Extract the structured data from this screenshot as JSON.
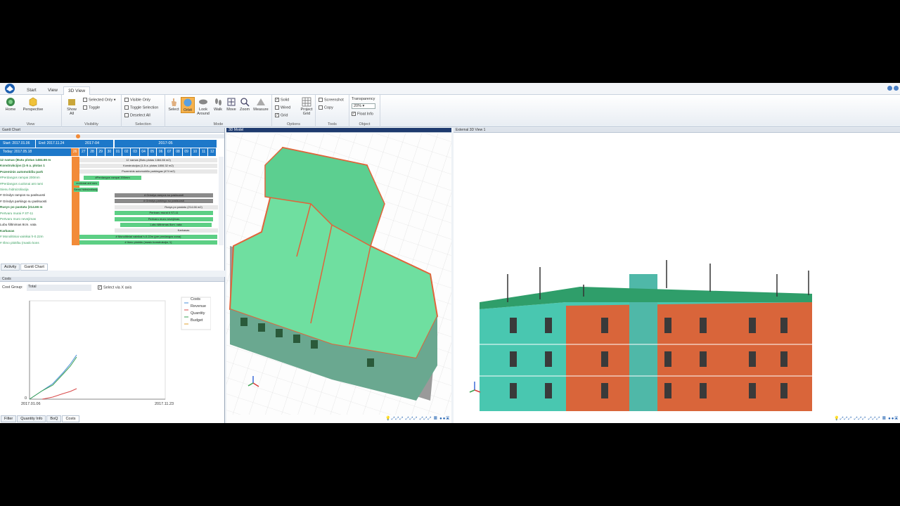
{
  "ribbon": {
    "tabs": [
      "Start",
      "View",
      "3D View"
    ],
    "active_tab": "3D View",
    "groups": {
      "view": {
        "label": "View",
        "home": "Home",
        "perspective": "Perspective"
      },
      "visibility": {
        "label": "Visibility",
        "show_all": "Show All",
        "selected_only": "Selected Only",
        "toggle": "Toggle"
      },
      "selection": {
        "label": "Selection",
        "visible_only": "Visible Only",
        "toggle_selection": "Toggle Selection",
        "deselect_all": "Deselect All"
      },
      "mode": {
        "label": "Mode",
        "select": "Select",
        "orbit": "Orbit",
        "look_around": "Look Around",
        "walk": "Walk",
        "move": "Move",
        "zoom": "Zoom",
        "measure": "Measure"
      },
      "options": {
        "label": "Options",
        "solid": "Solid",
        "wired": "Wired",
        "grid": "Grid",
        "project_grid": "Project Grid"
      },
      "tools": {
        "label": "Tools",
        "screenshot": "Screenshot",
        "copy": "Copy"
      },
      "object": {
        "label": "Object",
        "transparency": "Transparency",
        "transparency_value": "20%",
        "float_info": "Float Info"
      }
    }
  },
  "gantt": {
    "title": "Gantt Chart",
    "start": "Start: 2017.01.06",
    "end": "End: 2017.11.24",
    "today": "Today: 2017.05.18",
    "months": [
      "2017-04",
      "2017-05"
    ],
    "days": [
      "26",
      "27",
      "28",
      "29",
      "30",
      "01",
      "02",
      "03",
      "04",
      "05",
      "06",
      "07",
      "08",
      "09",
      "10",
      "11",
      "12"
    ],
    "rows": [
      {
        "label": "12 namas (Butu plotas 1484.66 m",
        "bar": "12 namas (Butu plotas 1484.66 m2)",
        "color": "#e8e8e8",
        "style": "g"
      },
      {
        "label": "Konstrukcijos (1-5 a. plotas 1",
        "bar": "Konstrukcijos (1-5 a. plotas 1806.32 m2)",
        "color": "#e8e8e8",
        "style": "g"
      },
      {
        "label": "Pozeminis automobiliu park",
        "bar": "Pozeminis automobiliu parkingas (474 m2)",
        "color": "#e8e8e8",
        "style": "g"
      },
      {
        "label": "#Perdangos rampai 200mm",
        "bar": "#Perdangos rampai 200mm",
        "color": "#5ccf84",
        "style": "t"
      },
      {
        "label": "#Perdangos cuolonai ant rami",
        "bar": "cuolonai ant ram",
        "color": "#5ccf84",
        "style": "t"
      },
      {
        "label": "Sienu hidroizoliacija",
        "bar": "Sienu hidroizoliacija",
        "color": "#5ccf84",
        "style": "t"
      },
      {
        "label": "# Grindys rampos su paslsuosti",
        "bar": "# Grindys rampos su paslsuosti",
        "color": "#8a8a8a",
        "style": "k"
      },
      {
        "label": "# Grindys parkingo su paslsuosti",
        "bar": "# Grindys parkingo su paslsuosti",
        "color": "#8a8a8a",
        "style": "k"
      },
      {
        "label": "Rusys po pastatu (214.66 m",
        "bar": "Rusys po pastatu (214.66 m2)",
        "color": "#e8e8e8",
        "style": "g"
      },
      {
        "label": "Pertvaru murai # ST-11",
        "bar": "Pertvaru murai # ST-11",
        "color": "#5ccf84",
        "style": "t"
      },
      {
        "label": "Pertvaru muro nevejimas",
        "bar": "Pertvaru muro nevejimas",
        "color": "#5ccf84",
        "style": "t"
      },
      {
        "label": "Lubu šiltinimas 8cm. vata",
        "bar": "Lubu šiltinimas 8cm. vata",
        "color": "#5ccf84",
        "style": "k"
      },
      {
        "label": "Karkasas",
        "bar": "Karkasas",
        "color": "#e8e8e8",
        "style": "g"
      },
      {
        "label": "# Monolitiniai vainikai h-0.22m",
        "bar": "# Monolitiniai vainikai h-0.22m (per perdangos zona)",
        "color": "#5ccf84",
        "style": "t"
      },
      {
        "label": "# Išmo plokštu (maslo kons",
        "bar": "# Išmo plokštu (maslo konstrukcija, 1)",
        "color": "#5ccf84",
        "style": "t"
      }
    ],
    "tabs": [
      "Activity",
      "Gantt Chart"
    ]
  },
  "costs": {
    "title": "Costs",
    "cost_group_label": "Cost Group:",
    "cost_group_value": "Total",
    "select_via_x": "Select via X axis",
    "legend": [
      "Costs",
      "Revenue",
      "Quantity",
      "Budget"
    ],
    "legend_colors": [
      "#4a8fd8",
      "#d84a4a",
      "#3aa050",
      "#e0a030"
    ],
    "xtick_start": "2017.01.06",
    "xtick_end": "2017.11.23",
    "ytick_zero": "0",
    "tabs": [
      "Filter",
      "Quantity Info",
      "BoQ",
      "Costs"
    ]
  },
  "viewports": {
    "model_title": "3D Model",
    "external_title": "External 3D View 1"
  }
}
